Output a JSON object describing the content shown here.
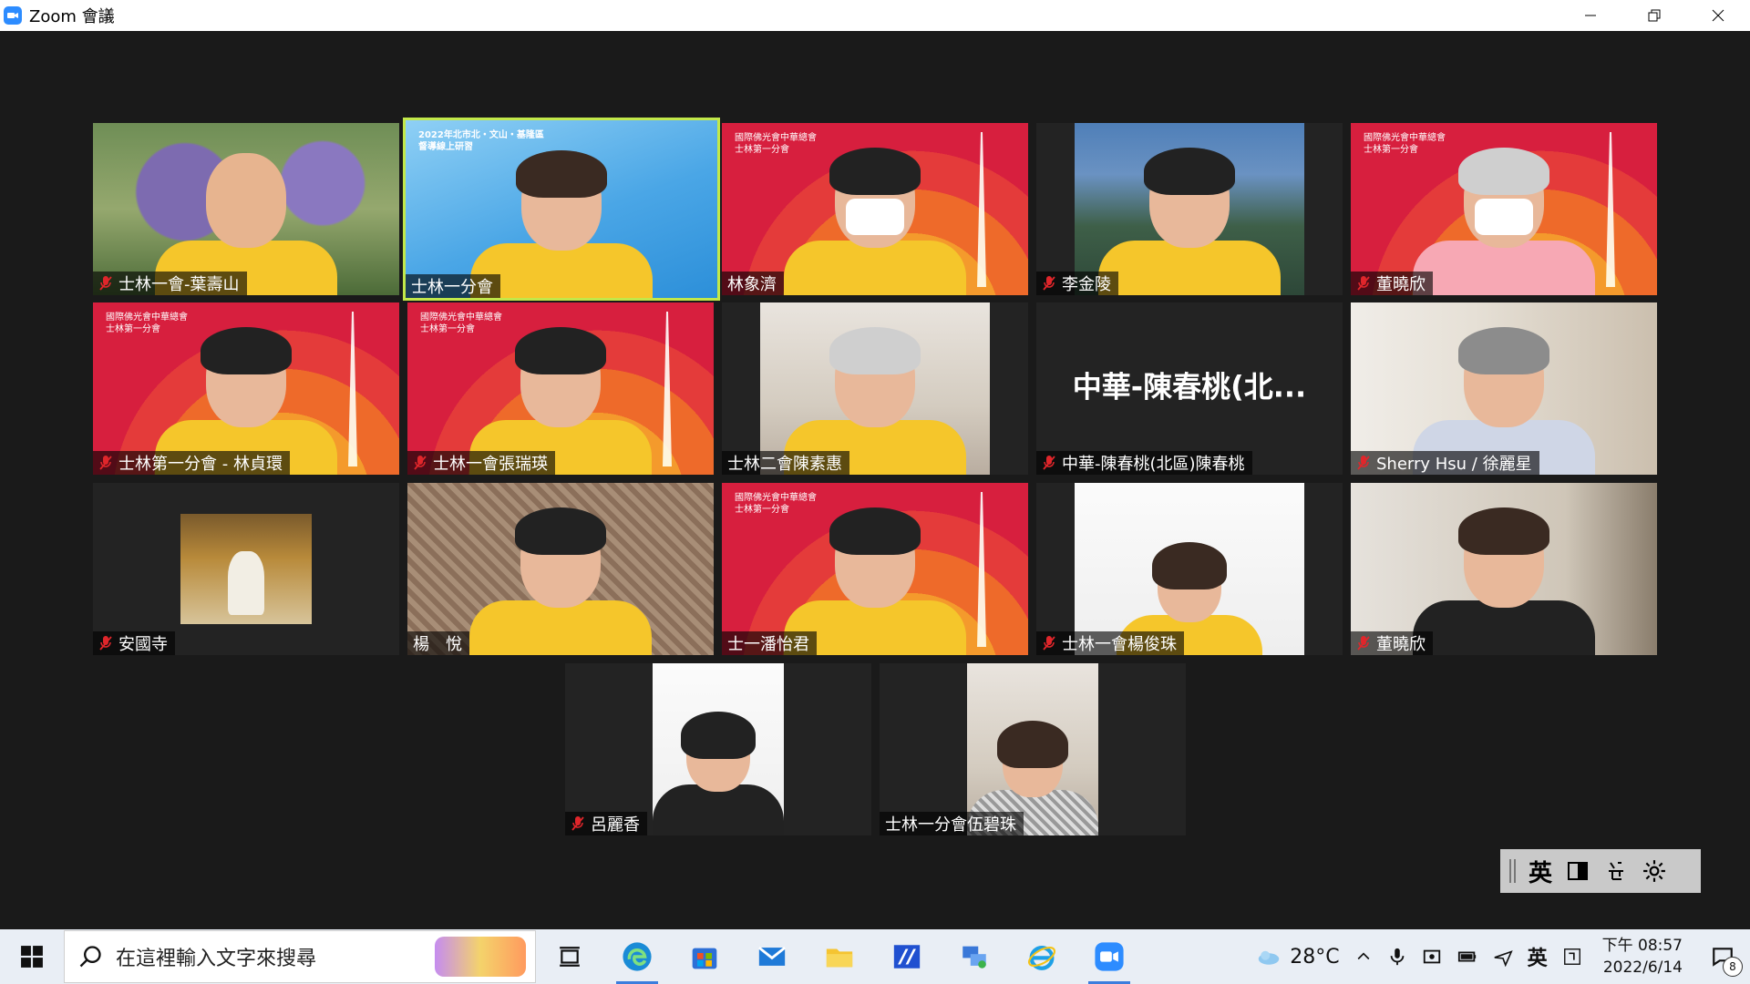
{
  "window": {
    "title": "Zoom 會議",
    "icon": "zoom-camera-icon",
    "controls": [
      "minimize-icon",
      "restore-icon",
      "close-icon"
    ]
  },
  "participants": [
    {
      "name": "士林一會-葉壽山",
      "muted": true,
      "bg": "garden"
    },
    {
      "name": "士林一分會",
      "muted": false,
      "bg": "blue",
      "active_speaker": true,
      "bg_text": "2022年北市北・文山・基隆區 督導線上研習"
    },
    {
      "name": "林象濟",
      "muted": false,
      "bg": "red",
      "masked": true,
      "bg_text": "國際佛光會中華總會 士林第一分會"
    },
    {
      "name": "李金陵",
      "muted": true,
      "bg": "mountain"
    },
    {
      "name": "董曉欣",
      "muted": true,
      "bg": "red",
      "masked": true,
      "bg_text": "國際佛光會中華總會 士林第一分會"
    },
    {
      "name": "士林第一分會 - 林貞環",
      "muted": true,
      "bg": "red",
      "bg_text": "國際佛光會中華總會 士林第一分會"
    },
    {
      "name": "士林一會張瑞瑛",
      "muted": true,
      "bg": "red",
      "bg_text": "國際佛光會中華總會 士林第一分會"
    },
    {
      "name": "士林二會陳素惠",
      "muted": false,
      "bg": "room"
    },
    {
      "name": "中華-陳春桃(北區)陳春桃",
      "muted": true,
      "bg": "none",
      "display_text": "中華-陳春桃(北..."
    },
    {
      "name": "Sherry Hsu / 徐麗星",
      "muted": true,
      "bg": "shelf"
    },
    {
      "name": "安國寺",
      "muted": true,
      "bg": "temple"
    },
    {
      "name": "楊　悅",
      "muted": false,
      "bg": "pattern"
    },
    {
      "name": "士一潘怡君",
      "muted": false,
      "bg": "red",
      "bg_text": "國際佛光會中華總會 士林第一分會"
    },
    {
      "name": "士林一會楊俊珠",
      "muted": true,
      "bg": "white"
    },
    {
      "name": "董曉欣",
      "muted": true,
      "bg": "room2"
    },
    {
      "name": "呂麗香",
      "muted": true,
      "bg": "white"
    },
    {
      "name": "士林一分會伍碧珠",
      "muted": false,
      "bg": "room"
    }
  ],
  "ime_toolbar": {
    "lang": "英",
    "icons": [
      "panel-icon",
      "pinyin-icon",
      "settings-gear-icon"
    ]
  },
  "taskbar": {
    "search_placeholder": "在這裡輸入文字來搜尋",
    "apps": [
      "task-view-icon",
      "edge-icon",
      "store-icon",
      "mail-icon",
      "file-explorer-icon",
      "remote-app-icon",
      "network-app-icon",
      "internet-explorer-icon",
      "zoom-icon"
    ],
    "weather_temp": "28°C",
    "ime_lang": "英",
    "time": "下午 08:57",
    "date": "2022/6/14",
    "notification_count": "8"
  },
  "colors": {
    "active_border": "#c2e84a",
    "zoom_blue": "#2d8cff",
    "mute_red": "#e0262b",
    "meeting_bg": "#1a1a1a"
  }
}
